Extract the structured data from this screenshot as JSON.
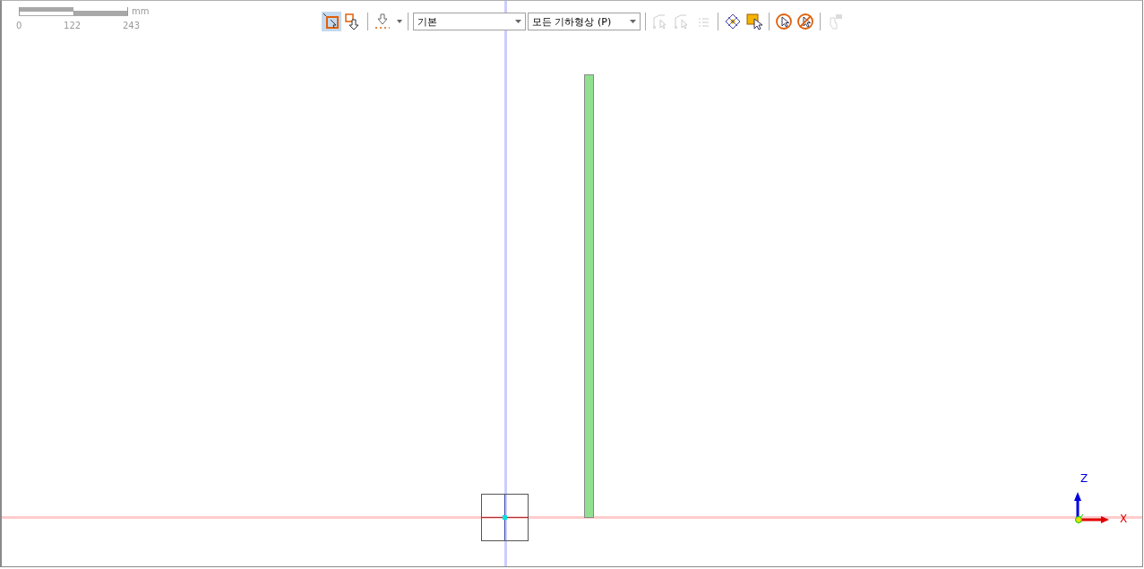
{
  "scale_bar": {
    "unit": "mm",
    "labels": [
      "0",
      "122",
      "243"
    ]
  },
  "toolbar": [
    {
      "kind": "button",
      "selected": true,
      "disabled": false
    },
    {
      "kind": "button",
      "selected": false,
      "disabled": false
    },
    {
      "kind": "separator"
    },
    {
      "kind": "menu-button",
      "selected": false,
      "disabled": false
    },
    {
      "kind": "separator"
    },
    {
      "kind": "dropdown",
      "value": "기본"
    },
    {
      "kind": "dropdown",
      "value": "모든 기하형상 (P)"
    },
    {
      "kind": "separator"
    },
    {
      "kind": "button",
      "selected": false,
      "disabled": true
    },
    {
      "kind": "button",
      "selected": false,
      "disabled": true
    },
    {
      "kind": "button",
      "selected": false,
      "disabled": true
    },
    {
      "kind": "separator"
    },
    {
      "kind": "button",
      "selected": false,
      "disabled": false
    },
    {
      "kind": "button",
      "selected": false,
      "disabled": false
    },
    {
      "kind": "separator"
    },
    {
      "kind": "button",
      "selected": false,
      "disabled": false
    },
    {
      "kind": "button",
      "selected": false,
      "disabled": false
    },
    {
      "kind": "separator"
    },
    {
      "kind": "button",
      "selected": false,
      "disabled": true
    }
  ],
  "axes": {
    "vertical": "Z",
    "horizontal": "X"
  }
}
